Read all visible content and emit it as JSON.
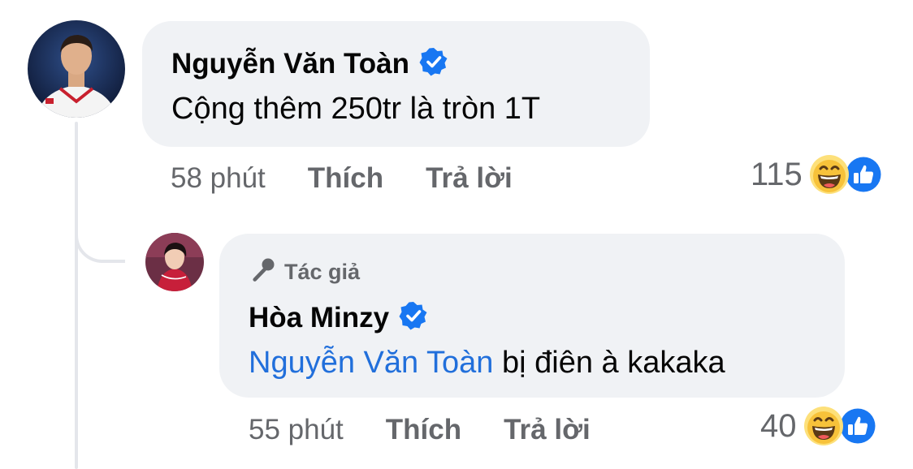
{
  "comment": {
    "author": "Nguyễn Văn Toàn",
    "text": "Cộng thêm 250tr là tròn 1T",
    "time": "58 phút",
    "like_label": "Thích",
    "reply_label": "Trả lời",
    "reaction_count": "115",
    "reactions": [
      "haha-icon",
      "like-icon"
    ]
  },
  "reply": {
    "badge_label": "Tác giả",
    "author": "Hòa Minzy",
    "mention": "Nguyễn Văn Toàn",
    "text": " bị điên à kakaka",
    "time": "55 phút",
    "like_label": "Thích",
    "reply_label": "Trả lời",
    "reaction_count": "40",
    "reactions": [
      "haha-icon",
      "like-icon"
    ]
  },
  "colors": {
    "bubble": "#f0f2f5",
    "secondary_text": "#65676b",
    "mention": "#216fdb",
    "verified": "#1877f2",
    "thread_line": "#e4e6eb"
  }
}
